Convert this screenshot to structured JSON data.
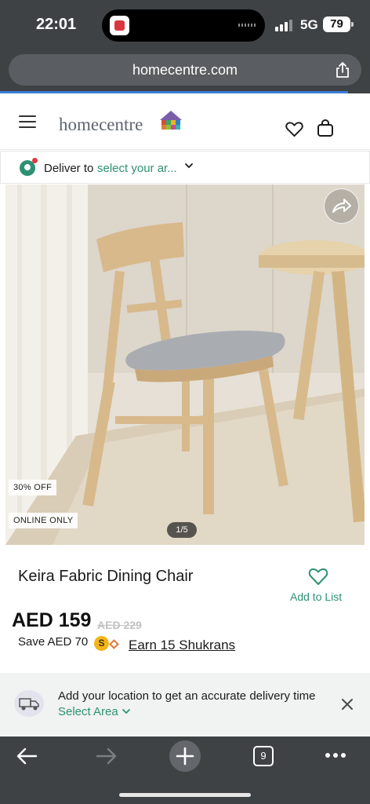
{
  "status_bar": {
    "time": "22:01",
    "network": "5G",
    "battery": "79"
  },
  "browser": {
    "url": "homecentre.com",
    "tab_count": "9",
    "load_progress": 0.94
  },
  "header": {
    "logo": "homecentre"
  },
  "deliver": {
    "label": "Deliver to",
    "area": "select your ar..."
  },
  "gallery": {
    "badge_discount": "30% OFF",
    "badge_online": "ONLINE ONLY",
    "counter": "1/5"
  },
  "product": {
    "title": "Keira Fabric Dining Chair",
    "add_to_list": "Add to List",
    "price": "AED 159",
    "old_price": "AED 229",
    "save": "Save AED 70",
    "coin": "S",
    "earn": "Earn 15 Shukrans"
  },
  "location_banner": {
    "text": "Add your location to get an accurate delivery time",
    "link": "Select Area"
  },
  "colors": {
    "brand_green": "#2e9173",
    "chrome": "#3f4245",
    "coin_gold": "#f2b51c"
  }
}
